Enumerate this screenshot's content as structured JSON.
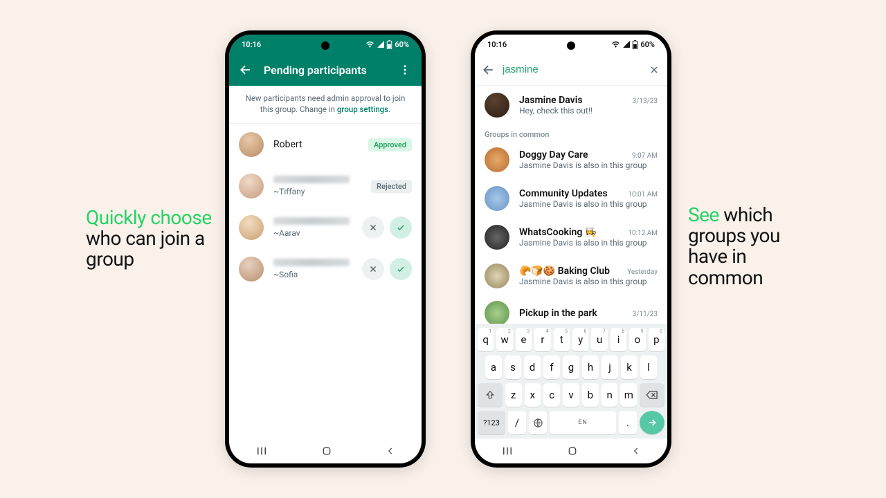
{
  "captions": {
    "left_accent": "Quickly choose",
    "left_rest": " who can join a group",
    "right_accent": "See",
    "right_rest": " which groups you have in common"
  },
  "status": {
    "time": "10:16",
    "battery": "60%"
  },
  "left": {
    "title": "Pending participants",
    "banner_a": "New participants need admin approval to join this group. Change in ",
    "banner_link": "group settings",
    "banner_b": ".",
    "rows": [
      {
        "name": "Robert",
        "status": "Approved"
      },
      {
        "sub": "~Tiffany",
        "status": "Rejected",
        "blurred": true
      },
      {
        "sub": "~Aarav",
        "blurred": true,
        "actions": true
      },
      {
        "sub": "~Sofia",
        "blurred": true,
        "actions": true
      }
    ]
  },
  "right": {
    "search": "jasmine",
    "top_chat": {
      "name": "Jasmine Davis",
      "msg": "Hey, check this out!!",
      "time": "3/13/23"
    },
    "section": "Groups in common",
    "groups": [
      {
        "name": "Doggy Day Care",
        "sub": "Jasmine Davis is also in this group",
        "time": "9:07 AM"
      },
      {
        "name": "Community Updates",
        "sub": "Jasmine Davis is also in this group",
        "time": "10:01 AM"
      },
      {
        "name": "WhatsCooking 👩‍🍳",
        "sub": "Jasmine Davis is also in this group",
        "time": "10:12 AM"
      },
      {
        "name": "🥐🍞🍪 Baking Club",
        "sub": "Jasmine Davis is also in this group",
        "time": "Yesterday"
      },
      {
        "name": "Pickup in the park",
        "sub": "",
        "time": "3/11/23"
      }
    ],
    "keys_r1": [
      "q",
      "w",
      "e",
      "r",
      "t",
      "y",
      "u",
      "i",
      "o",
      "p"
    ],
    "keys_r2": [
      "a",
      "s",
      "d",
      "f",
      "g",
      "h",
      "j",
      "k",
      "l"
    ],
    "keys_r3": [
      "z",
      "x",
      "c",
      "v",
      "b",
      "n",
      "m"
    ],
    "sym": "?123",
    "lang": "EN"
  }
}
